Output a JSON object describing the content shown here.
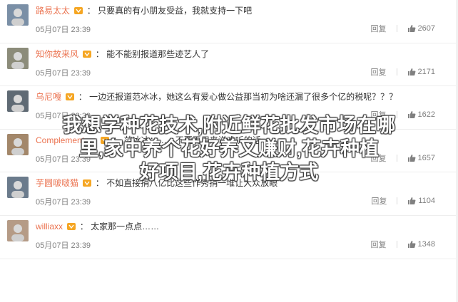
{
  "comments": [
    {
      "username": "路易太太",
      "text": "只要真的有小朋友受益，我就支持一下吧",
      "time": "05月07日 23:39",
      "reply": "回复",
      "likes": "2607",
      "avatar_color": "#7a8fa6"
    },
    {
      "username": "知你故来风",
      "text": "能不能别报道那些迹艺人了",
      "time": "05月07日 23:39",
      "reply": "回复",
      "likes": "2171",
      "avatar_color": "#8c8c7a"
    },
    {
      "username": "乌尼嘎",
      "text": "一边还报道范冰冰，她这么有爱心做公益那当初为啥还漏了很多个亿的税呢？？？",
      "time": "05月07日 23:39",
      "reply": "回复",
      "likes": "1622",
      "avatar_color": "#5f6a74"
    },
    {
      "username": "Complementary",
      "text": "范冰冰：……不要再用来说难听的话",
      "time": "05月07日 23:39",
      "reply": "回复",
      "likes": "1657",
      "avatar_color": "#a3876a"
    },
    {
      "username": "芋圆啵啵猫",
      "text": "不如直接捐八亿比这些作秀捐一堆让大众放眼",
      "time": "05月07日 23:39",
      "reply": "回复",
      "likes": "1104",
      "avatar_color": "#6b7b8c"
    },
    {
      "username": "williaxx",
      "text": "太家那一点点……",
      "time": "05月07日 23:39",
      "reply": "回复",
      "likes": "1348",
      "avatar_color": "#b59b86"
    }
  ],
  "overlay": {
    "line1": "我想学种花技术,附近鲜花批发市场在哪",
    "line2": "里,家中养个花好养又赚财,花卉种植",
    "line3": "好项目,花卉种植方式"
  },
  "colors": {
    "username": "#eb7350",
    "vip": "#f5a623",
    "meta": "#808080"
  }
}
